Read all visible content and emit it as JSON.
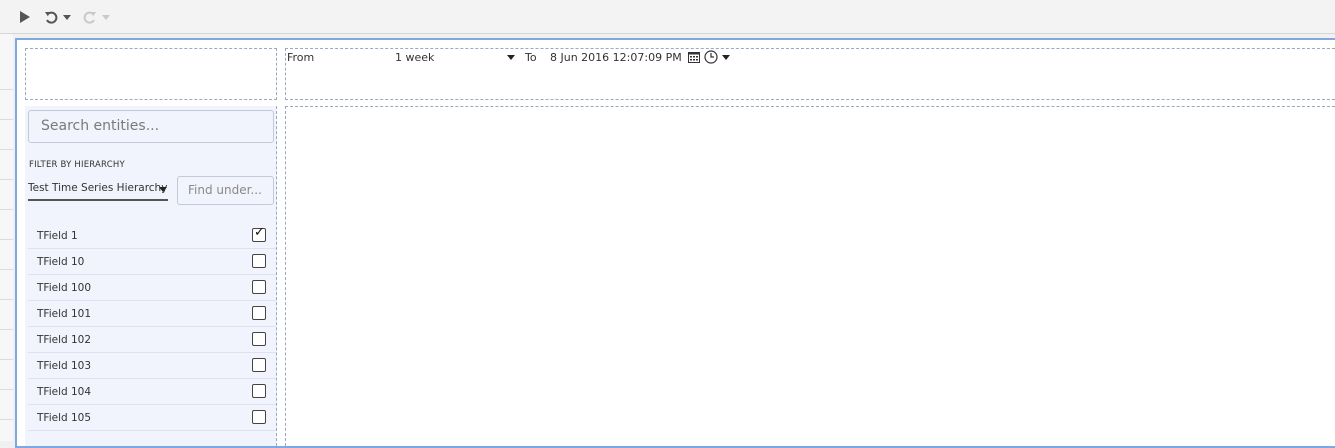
{
  "toolbar": {
    "icons": [
      "play-icon",
      "undo-icon",
      "chevron-down-icon",
      "redo-icon",
      "chevron-down-icon"
    ]
  },
  "time_range": {
    "from_label": "From",
    "from_value": "1 week",
    "to_label": "To",
    "to_value": "8 Jun 2016 12:07:09 PM",
    "icons": [
      "calendar-icon",
      "clock-icon",
      "chevron-down-icon"
    ]
  },
  "sidebar": {
    "search_placeholder": "Search entities...",
    "filter_label": "FILTER BY HIERARCHY",
    "hierarchy_value": "Test Time Series Hierarchy",
    "find_placeholder": "Find under...",
    "items": [
      {
        "label": "TField 1",
        "checked": true
      },
      {
        "label": "TField 10",
        "checked": false
      },
      {
        "label": "TField 100",
        "checked": false
      },
      {
        "label": "TField 101",
        "checked": false
      },
      {
        "label": "TField 102",
        "checked": false
      },
      {
        "label": "TField 103",
        "checked": false
      },
      {
        "label": "TField 104",
        "checked": false
      },
      {
        "label": "TField 105",
        "checked": false
      }
    ]
  }
}
